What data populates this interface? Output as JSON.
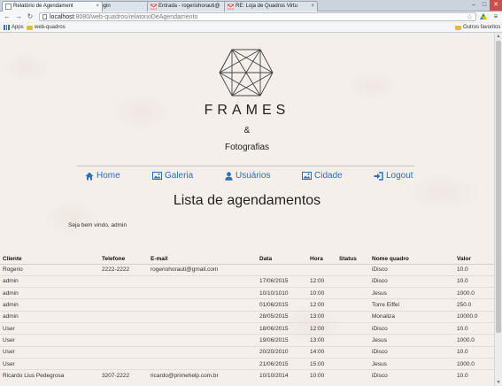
{
  "browser": {
    "tabs": [
      {
        "title": "Relatório de Agendament",
        "active": true
      },
      {
        "title": "Login",
        "active": false
      },
      {
        "title": "Entrada - rogeriohorauti@",
        "active": false
      },
      {
        "title": "RE: Loja de Quadros Virtu",
        "active": false
      }
    ],
    "url_host": "localhost",
    "url_rest": ":8080/web-quadros/relatorioDeAgendamento",
    "bookmarks": {
      "apps": "Apps",
      "folder": "web-quadros",
      "other": "Outros favoritos"
    }
  },
  "brand": {
    "title": "FRAMES",
    "amp": "&",
    "subtitle": "Fotografias"
  },
  "nav": {
    "home": "Home",
    "galeria": "Galeria",
    "usuarios": "Usuários",
    "cidade": "Cidade",
    "logout": "Logout"
  },
  "page": {
    "heading": "Lista de agendamentos",
    "welcome": "Seja bem vindo, admin"
  },
  "table": {
    "headers": [
      "Cliente",
      "Telefone",
      "E-mail",
      "Data",
      "Hora",
      "Status",
      "Nome quadro",
      "Valor"
    ],
    "rows": [
      [
        "Rogerio",
        "2222-2222",
        "rogeriohorauti@gmail.com",
        "",
        "",
        "",
        "iDisco",
        "10.0"
      ],
      [
        "admin",
        "",
        "",
        "17/06/2015",
        "12:00",
        "",
        "iDisco",
        "10.0"
      ],
      [
        "admin",
        "",
        "",
        "10/10/1010",
        "10:00",
        "",
        "Jesus",
        "1000.0"
      ],
      [
        "admin",
        "",
        "",
        "01/06/2015",
        "12:00",
        "",
        "Torre Eiffel",
        "250.0"
      ],
      [
        "admin",
        "",
        "",
        "28/05/2015",
        "13:00",
        "",
        "Monaliza",
        "10000.0"
      ],
      [
        "User",
        "",
        "",
        "18/06/2015",
        "12:00",
        "",
        "iDisco",
        "10.0"
      ],
      [
        "User",
        "",
        "",
        "19/06/2015",
        "13:00",
        "",
        "Jesus",
        "1000.0"
      ],
      [
        "User",
        "",
        "",
        "20/20/2010",
        "14:00",
        "",
        "iDisco",
        "10.0"
      ],
      [
        "User",
        "",
        "",
        "21/06/2015",
        "15:00",
        "",
        "Jesus",
        "1000.0"
      ],
      [
        "Ricardo Lius Pedegrosa",
        "3207-2222",
        "ricardo@primehelp.com.br",
        "10/10/2014",
        "10:00",
        "",
        "iDisco",
        "10.0"
      ]
    ]
  },
  "colors": {
    "link": "#2f6db4",
    "close": "#c7504a"
  }
}
